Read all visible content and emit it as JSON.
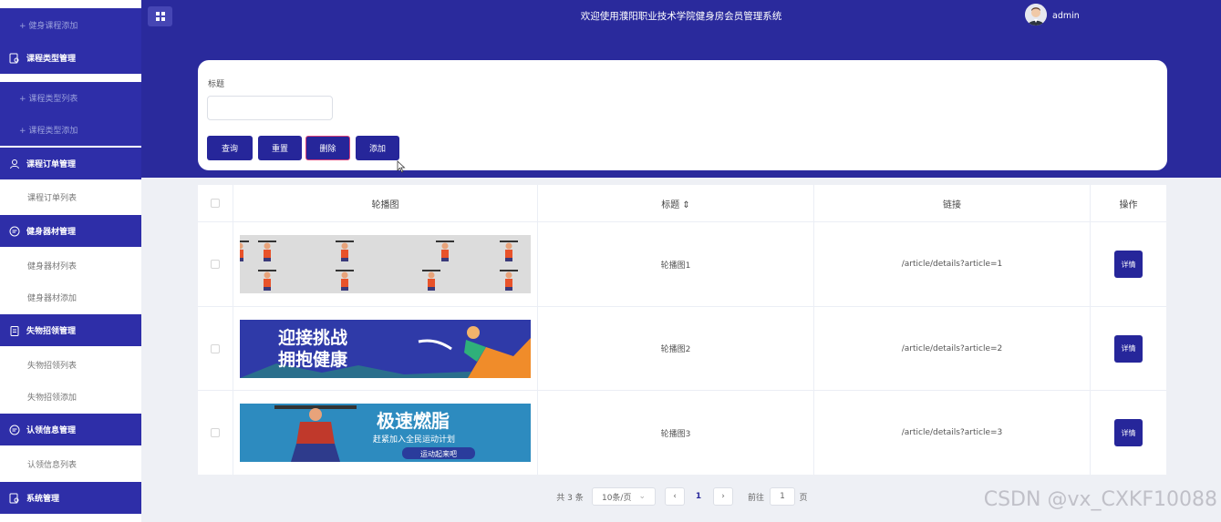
{
  "sidebar": {
    "items": [
      {
        "type": "sub-dark",
        "label": "+ 健身课程添加"
      },
      {
        "type": "group",
        "label": "课程类型管理",
        "icon": "doc-search-icon"
      },
      {
        "type": "sub-dark",
        "label": "+ 课程类型列表"
      },
      {
        "type": "sub-dark",
        "label": "+ 课程类型添加"
      },
      {
        "type": "group",
        "label": "课程订单管理",
        "icon": "user-icon"
      },
      {
        "type": "sub-light",
        "label": "课程订单列表"
      },
      {
        "type": "group",
        "label": "健身器材管理",
        "icon": "chat-bubble-icon"
      },
      {
        "type": "sub-light",
        "label": "健身器材列表"
      },
      {
        "type": "sub-light",
        "label": "健身器材添加"
      },
      {
        "type": "group",
        "label": "失物招领管理",
        "icon": "clipboard-icon"
      },
      {
        "type": "sub-light",
        "label": "失物招领列表"
      },
      {
        "type": "sub-light",
        "label": "失物招领添加"
      },
      {
        "type": "group",
        "label": "认领信息管理",
        "icon": "chat-bubble-icon"
      },
      {
        "type": "sub-light",
        "label": "认领信息列表"
      },
      {
        "type": "group",
        "label": "系统管理",
        "icon": "doc-search-icon"
      }
    ]
  },
  "header": {
    "title": "欢迎使用濮阳职业技术学院健身房会员管理系统",
    "username": "admin",
    "menu_icon": "grid-icon"
  },
  "search": {
    "title_label": "标题",
    "title_value": "",
    "title_placeholder": "",
    "buttons": {
      "query": "查询",
      "reset": "重置",
      "delete": "删除",
      "add": "添加"
    }
  },
  "table": {
    "columns": [
      "轮播图",
      "标题 ⇕",
      "链接",
      "操作"
    ],
    "rows": [
      {
        "title": "轮播图1",
        "link": "/article/details?article=1",
        "action": "详情",
        "banner": "cartoon-exercise-figures"
      },
      {
        "title": "轮播图2",
        "link": "/article/details?article=2",
        "action": "详情",
        "banner_text_1": "迎接挑战",
        "banner_text_2": "拥抱健康"
      },
      {
        "title": "轮播图3",
        "link": "/article/details?article=3",
        "action": "详情",
        "banner_text_1": "极速燃脂",
        "banner_text_2": "赶紧加入全民运动计划",
        "banner_text_3": "运动起来吧"
      }
    ]
  },
  "pagination": {
    "total": "共 3 条",
    "page_size": "10条/页",
    "prev": "‹",
    "current": "1",
    "next": "›",
    "goto_label": "前往",
    "goto_value": "1",
    "page_unit": "页"
  },
  "watermark": "CSDN @vx_CXKF10088",
  "colors": {
    "primary": "#2a2a9c",
    "sidebar_group": "#2e2ea8",
    "delete_border": "#d8427a"
  }
}
